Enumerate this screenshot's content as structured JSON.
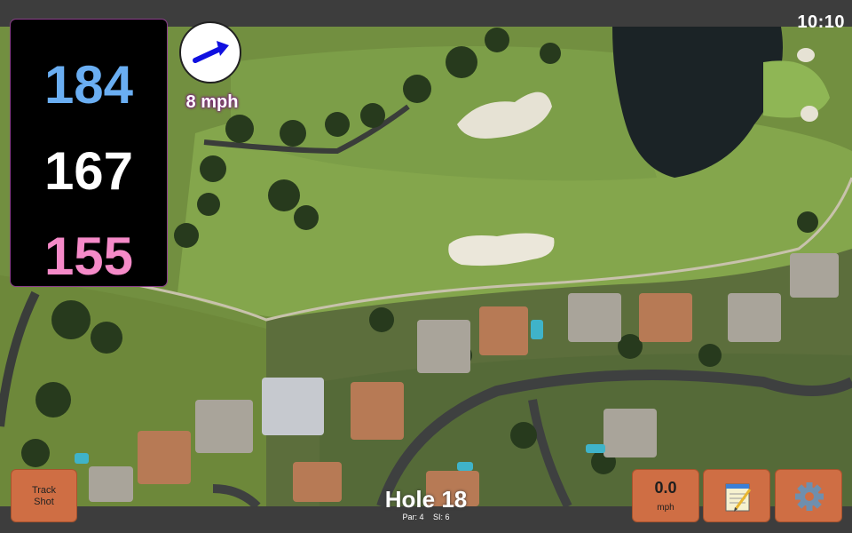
{
  "status": {
    "time": "10:10"
  },
  "distances": {
    "back": "184",
    "middle": "167",
    "front": "155"
  },
  "wind": {
    "speed_label": "8 mph",
    "direction_icon": "arrow-icon"
  },
  "hole": {
    "title": "Hole 18",
    "par_label": "Par: 4",
    "si_label": "SI: 6"
  },
  "buttons": {
    "track_shot_line1": "Track",
    "track_shot_line2": "Shot",
    "speed_value": "0.0",
    "speed_unit": "mph",
    "notes_icon": "notepad-icon",
    "settings_icon": "gear-icon"
  },
  "colors": {
    "back_distance": "#6aaef2",
    "middle_distance": "#ffffff",
    "front_distance": "#f58ac8",
    "button": "#cf6e44",
    "panel": "#000000",
    "wind_arrow": "#1010e0"
  }
}
